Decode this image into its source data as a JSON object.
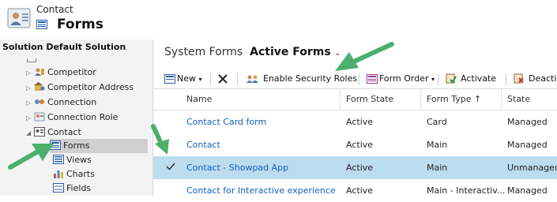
{
  "header": {
    "entity_label": "Contact",
    "title": "Forms"
  },
  "sidebar": {
    "title": "Solution Default Solution",
    "items": [
      {
        "label": "Competitor"
      },
      {
        "label": "Competitor Address"
      },
      {
        "label": "Connection"
      },
      {
        "label": "Connection Role"
      },
      {
        "label": "Contact"
      },
      {
        "label": "Forms"
      },
      {
        "label": "Views"
      },
      {
        "label": "Charts"
      },
      {
        "label": "Fields"
      }
    ]
  },
  "main": {
    "view_prefix": "System Forms",
    "view_name": "Active Forms",
    "toolbar": {
      "new_label": "New",
      "enable_security_roles_label": "Enable Security Roles",
      "form_order_label": "Form Order",
      "activate_label": "Activate",
      "deactivate_label": "Deacti"
    },
    "columns": [
      "Name",
      "Form State",
      "Form Type",
      "State"
    ],
    "rows": [
      {
        "name": "Contact Card form",
        "form_state": "Active",
        "form_type": "Card",
        "state": "Managed"
      },
      {
        "name": "Contact",
        "form_state": "Active",
        "form_type": "Main",
        "state": "Managed"
      },
      {
        "name": "Contact - Showpad App",
        "form_state": "Active",
        "form_type": "Main",
        "state": "Unmanaged"
      },
      {
        "name": "Contact for Interactive experience",
        "form_state": "Active",
        "form_type": "Main - Interactiv...",
        "state": "Managed"
      }
    ]
  },
  "colors": {
    "selected_row": "#bcdcf0",
    "link": "#1160b7",
    "annotation_arrow": "#4caf6e"
  },
  "icons": [
    "contact-entity-icon",
    "forms-icon",
    "expand-arrow-icon",
    "new-icon",
    "delete-icon",
    "security-roles-icon",
    "form-order-icon",
    "activate-icon",
    "deactivate-icon",
    "sort-ascending-icon",
    "checkmark-icon"
  ]
}
